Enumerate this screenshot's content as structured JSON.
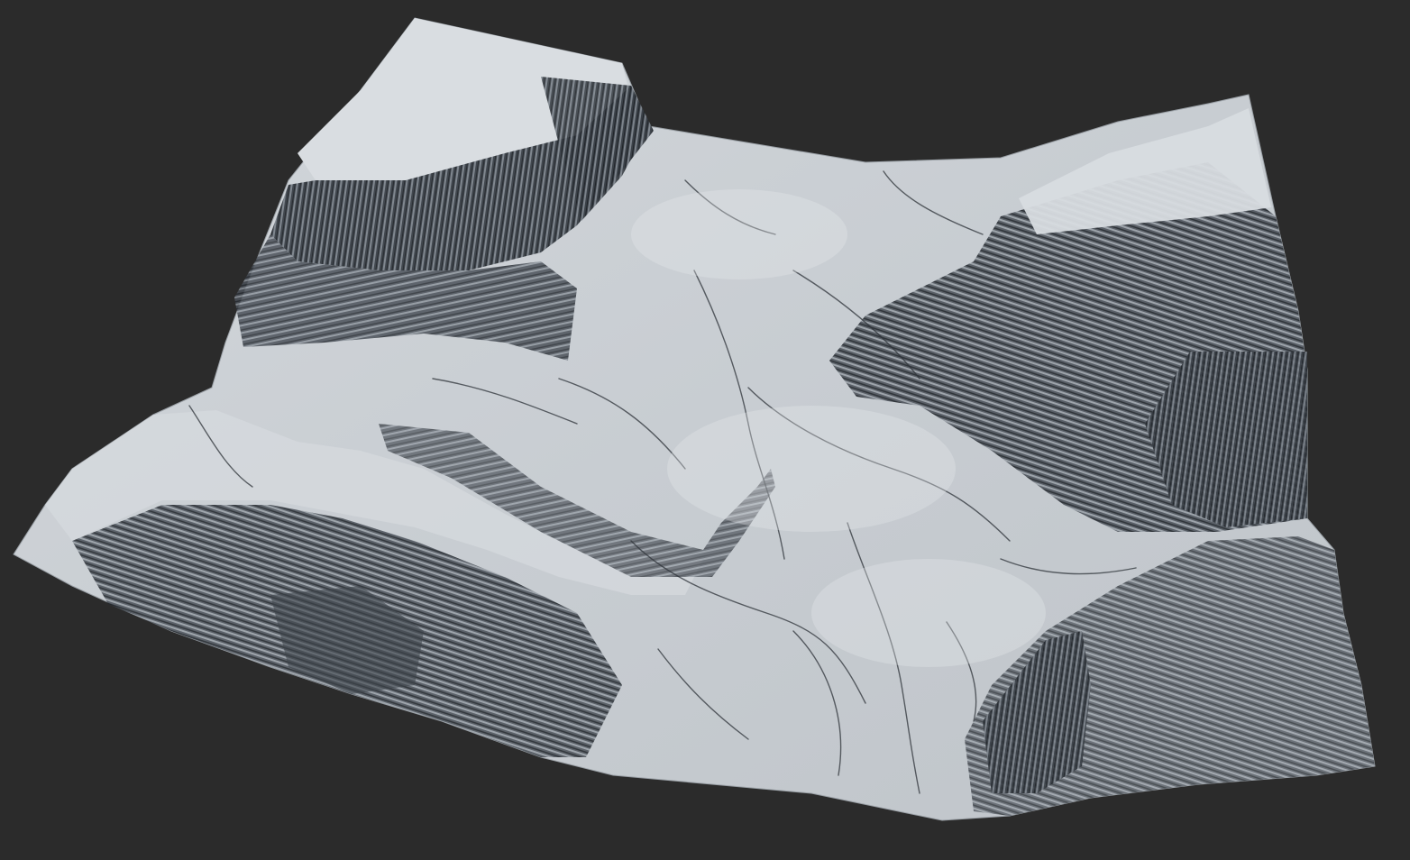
{
  "scene": {
    "background_color": "#2b2b2b",
    "subject": "terrain-render",
    "terrain": {
      "base_color": "#c9ced3",
      "highlight_color": "#e6e9ec",
      "shadow_color": "#4a5058",
      "deep_shadow_color": "#262b31",
      "crack_color": "#2f343a"
    }
  }
}
